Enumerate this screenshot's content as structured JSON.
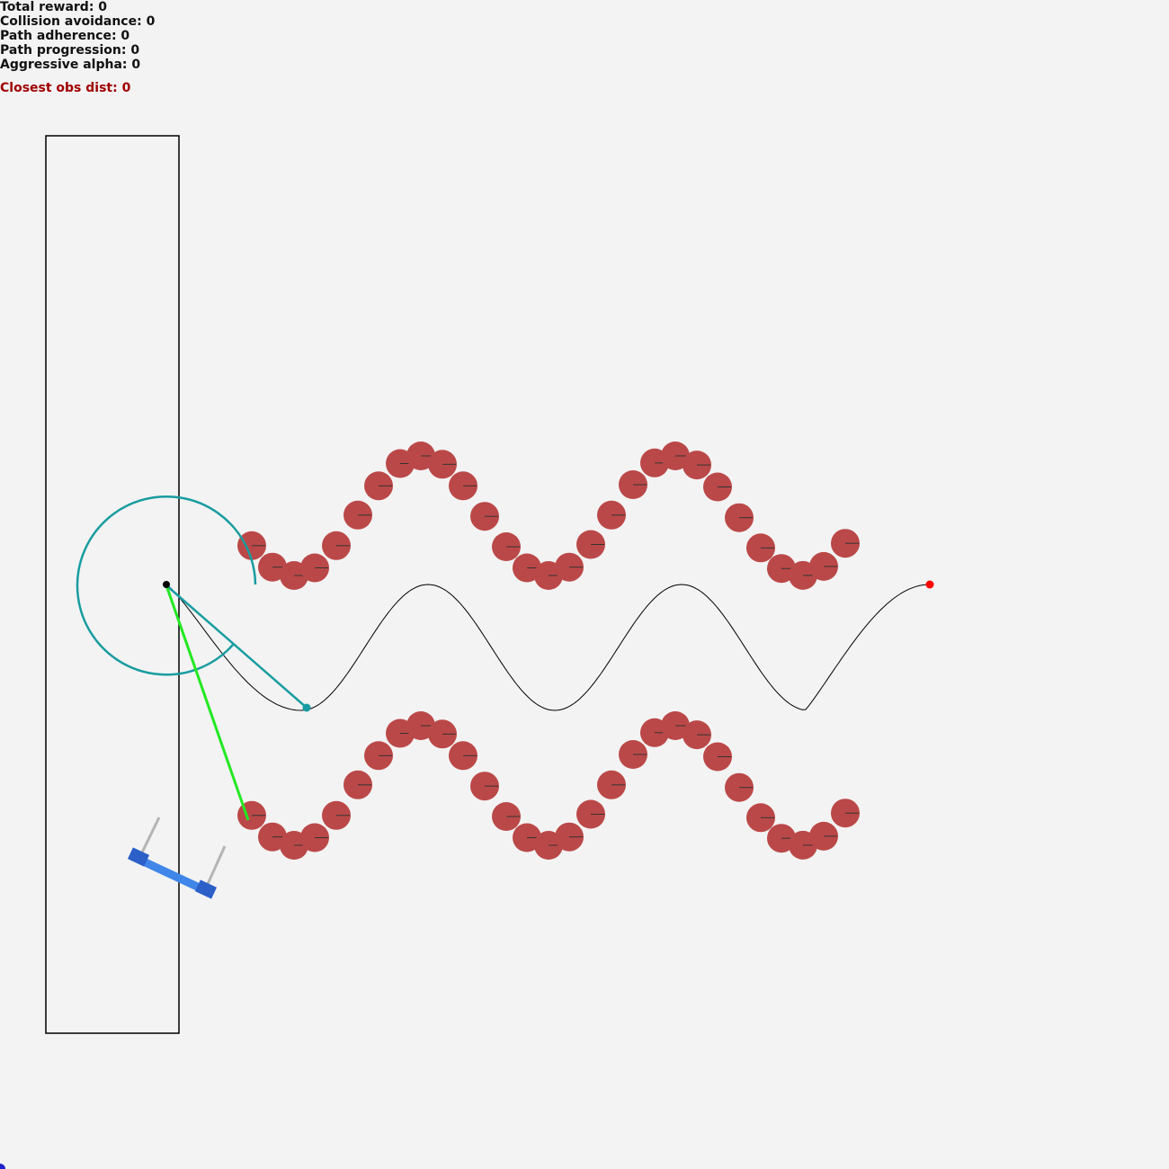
{
  "hud": {
    "total_reward": "Total reward: 0",
    "collision_avoidance": "Collision avoidance: 0",
    "path_adherence": "Path adherence: 0",
    "path_progression": "Path progression: 0",
    "aggressive_alpha": "Aggressive alpha: 0",
    "closest_obs_dist": "Closest obs dist: 0"
  },
  "colors": {
    "background": "#f3f3f3",
    "obstacle": "#bb4848",
    "lookahead": "#189ca0",
    "closest_obstacle_ray": "#22e822",
    "path": "#000000",
    "goal": "#ff0000",
    "robot_body": "#3f86e8",
    "robot_wheel": "#2c5fc8",
    "sensor": "#b4b4b4"
  },
  "scene": {
    "elements": [
      "workspace-boundary",
      "reference-path",
      "obstacles-upper-row",
      "obstacles-lower-row",
      "lookahead-circle",
      "lookahead-target",
      "closest-obstacle-ray",
      "robot",
      "goal-marker"
    ]
  }
}
